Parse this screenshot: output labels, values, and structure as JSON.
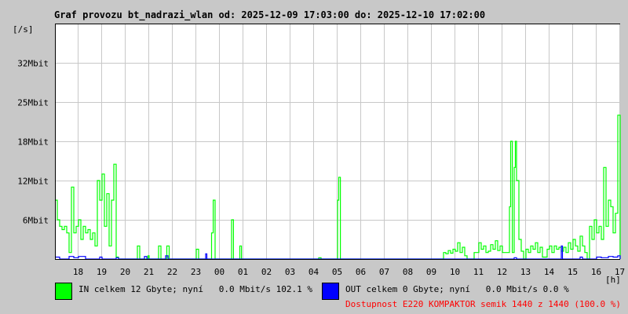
{
  "chart_data": {
    "type": "line",
    "title": "Graf provozu bt_nadrazi_wlan od: 2025-12-09 17:03:00 do: 2025-12-10 17:02:00",
    "ylabel": "[/s]",
    "xlabel": "[h]",
    "ylim_mbit": [
      0,
      36
    ],
    "xlim_hours_from_1700": [
      0,
      24
    ],
    "grid": true,
    "y_ticks": [
      {
        "value": 6,
        "label": "6Mbit"
      },
      {
        "value": 12,
        "label": "12Mbit"
      },
      {
        "value": 18,
        "label": "18Mbit"
      },
      {
        "value": 25,
        "label": "25Mbit"
      },
      {
        "value": 32,
        "label": "32Mbit"
      }
    ],
    "x_ticks": [
      "18",
      "19",
      "20",
      "21",
      "22",
      "23",
      "00",
      "01",
      "02",
      "03",
      "04",
      "05",
      "06",
      "07",
      "08",
      "09",
      "10",
      "11",
      "12",
      "13",
      "14",
      "15",
      "16",
      "17"
    ],
    "series": [
      {
        "name": "IN",
        "color": "#00ff00",
        "points": [
          [
            0.0,
            9
          ],
          [
            0.1,
            6
          ],
          [
            0.2,
            5
          ],
          [
            0.3,
            4.5
          ],
          [
            0.4,
            5
          ],
          [
            0.5,
            4
          ],
          [
            0.6,
            1
          ],
          [
            0.7,
            11
          ],
          [
            0.8,
            4
          ],
          [
            0.9,
            5
          ],
          [
            1.0,
            6
          ],
          [
            1.1,
            3
          ],
          [
            1.2,
            5
          ],
          [
            1.3,
            4
          ],
          [
            1.4,
            4.5
          ],
          [
            1.5,
            3
          ],
          [
            1.6,
            4
          ],
          [
            1.7,
            2
          ],
          [
            1.8,
            12
          ],
          [
            1.9,
            9
          ],
          [
            2.0,
            13
          ],
          [
            2.1,
            5
          ],
          [
            2.2,
            10
          ],
          [
            2.3,
            2
          ],
          [
            2.4,
            9
          ],
          [
            2.5,
            14.5
          ],
          [
            2.6,
            0.3
          ],
          [
            2.7,
            0
          ],
          [
            3.5,
            2
          ],
          [
            3.6,
            0
          ],
          [
            3.95,
            0.5
          ],
          [
            4.0,
            0
          ],
          [
            4.4,
            2
          ],
          [
            4.5,
            0
          ],
          [
            4.75,
            2
          ],
          [
            4.85,
            0
          ],
          [
            6.0,
            1.5
          ],
          [
            6.1,
            0
          ],
          [
            6.65,
            4
          ],
          [
            6.72,
            9
          ],
          [
            6.8,
            0
          ],
          [
            7.5,
            6
          ],
          [
            7.58,
            0
          ],
          [
            7.85,
            2
          ],
          [
            7.92,
            0
          ],
          [
            11.2,
            0.2
          ],
          [
            11.3,
            0
          ],
          [
            12.0,
            9
          ],
          [
            12.05,
            12.5
          ],
          [
            12.12,
            0
          ],
          [
            16.5,
            1
          ],
          [
            16.6,
            0.8
          ],
          [
            16.7,
            1.3
          ],
          [
            16.8,
            0.9
          ],
          [
            16.9,
            1.5
          ],
          [
            17.0,
            1.2
          ],
          [
            17.1,
            2.5
          ],
          [
            17.2,
            1
          ],
          [
            17.3,
            1.8
          ],
          [
            17.4,
            0.5
          ],
          [
            17.5,
            0
          ],
          [
            17.8,
            1
          ],
          [
            18.0,
            2.5
          ],
          [
            18.1,
            1.5
          ],
          [
            18.2,
            2
          ],
          [
            18.3,
            1
          ],
          [
            18.4,
            1.2
          ],
          [
            18.5,
            2.2
          ],
          [
            18.6,
            1.5
          ],
          [
            18.7,
            2.8
          ],
          [
            18.8,
            1.3
          ],
          [
            18.9,
            2
          ],
          [
            19.0,
            1
          ],
          [
            19.2,
            1
          ],
          [
            19.3,
            8
          ],
          [
            19.35,
            18
          ],
          [
            19.42,
            1
          ],
          [
            19.5,
            14
          ],
          [
            19.55,
            18
          ],
          [
            19.6,
            12
          ],
          [
            19.7,
            3
          ],
          [
            19.8,
            1.2
          ],
          [
            19.9,
            0
          ],
          [
            20.0,
            1.5
          ],
          [
            20.1,
            1
          ],
          [
            20.2,
            2
          ],
          [
            20.3,
            1.5
          ],
          [
            20.4,
            2.5
          ],
          [
            20.5,
            1
          ],
          [
            20.6,
            1.8
          ],
          [
            20.7,
            0.3
          ],
          [
            20.9,
            1.5
          ],
          [
            21.0,
            2
          ],
          [
            21.1,
            1
          ],
          [
            21.2,
            2
          ],
          [
            21.3,
            1.5
          ],
          [
            21.4,
            1.8
          ],
          [
            21.5,
            1.2
          ],
          [
            21.6,
            1.8
          ],
          [
            21.7,
            1
          ],
          [
            21.8,
            2.5
          ],
          [
            21.9,
            1.5
          ],
          [
            22.0,
            3
          ],
          [
            22.1,
            2
          ],
          [
            22.2,
            1.2
          ],
          [
            22.3,
            3.5
          ],
          [
            22.4,
            2
          ],
          [
            22.5,
            1
          ],
          [
            22.6,
            0
          ],
          [
            22.7,
            5
          ],
          [
            22.8,
            3
          ],
          [
            22.9,
            6
          ],
          [
            23.0,
            4
          ],
          [
            23.1,
            5
          ],
          [
            23.2,
            3
          ],
          [
            23.3,
            14
          ],
          [
            23.4,
            5
          ],
          [
            23.5,
            9
          ],
          [
            23.6,
            8
          ],
          [
            23.7,
            4
          ],
          [
            23.8,
            7
          ],
          [
            23.9,
            22
          ],
          [
            24.0,
            0
          ]
        ]
      },
      {
        "name": "OUT",
        "color": "#0000ff",
        "points": [
          [
            0.0,
            0.3
          ],
          [
            0.2,
            0
          ],
          [
            0.6,
            0.4
          ],
          [
            0.8,
            0.2
          ],
          [
            1.0,
            0.4
          ],
          [
            1.3,
            0
          ],
          [
            1.9,
            0.3
          ],
          [
            2.0,
            0
          ],
          [
            2.6,
            0.2
          ],
          [
            2.7,
            0
          ],
          [
            3.8,
            0.4
          ],
          [
            3.9,
            0
          ],
          [
            4.7,
            0.5
          ],
          [
            4.8,
            0
          ],
          [
            6.4,
            0.8
          ],
          [
            6.45,
            0
          ],
          [
            19.5,
            0.2
          ],
          [
            19.6,
            0
          ],
          [
            21.5,
            2
          ],
          [
            21.55,
            0
          ],
          [
            22.3,
            0.3
          ],
          [
            22.4,
            0
          ],
          [
            23.0,
            0.3
          ],
          [
            23.2,
            0.2
          ],
          [
            23.5,
            0.4
          ],
          [
            23.7,
            0.3
          ],
          [
            23.9,
            0.5
          ],
          [
            24.0,
            0
          ]
        ]
      }
    ]
  },
  "legend": {
    "in": "IN celkem 12 Gbyte; nyní   0.0 Mbit/s 102.1 %",
    "out": "OUT celkem 0 Gbyte; nyní   0.0 Mbit/s 0.0 %",
    "availability": "Dostupnost E220 KOMPAKTOR semik 1440 z 1440 (100.0 %)"
  }
}
